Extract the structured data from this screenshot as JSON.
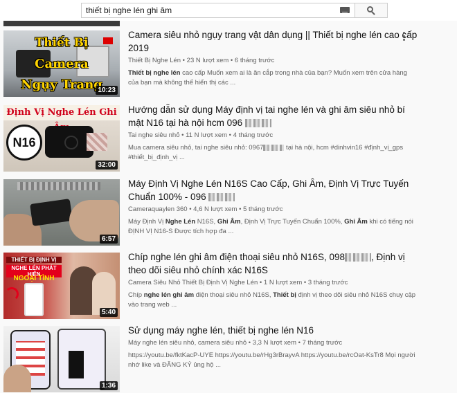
{
  "search": {
    "query": "thiết bị nghe lén ghi âm",
    "icons": {
      "keyboard": "keyboard-icon",
      "search": "search-icon"
    }
  },
  "results": [
    {
      "title": "Camera siêu nhỏ ngụy trang vật dân dụng || Thiết bị nghe lén cao cấp 2019",
      "channel": "Thiết Bị Nghe Lén",
      "views": "23 N lượt xem",
      "age": "6 tháng trước",
      "desc_bold": "Thiết bị nghe lén",
      "desc": " cao cấp Muốn xem ai là ăn cắp trong nhà của bạn? Muốn xem trên cửa hàng của bạn mà không thể hiển thị các ...",
      "duration": "10:23",
      "thumb_text": [
        "Thiết Bị",
        "Camera",
        "Ngụy Trang"
      ]
    },
    {
      "title_a": "Hướng dẫn sử dụng Máy định vị tai nghe lén và ghi âm siêu nhỏ bí mật N16 tại hà nội hcm 096",
      "channel": "Tai nghe siêu nhỏ",
      "views": "11 N lượt xem",
      "age": "4 tháng trước",
      "desc_a": "Mua camera siêu nhỏ, tai nghe siêu nhỏ: 0967",
      "desc_b": " tại hà nội, hcm #dinhvin16 #định_vị_gps #thiết_bị_định_vị ...",
      "duration": "32:00",
      "thumb_head": "Định Vị Nghe Lén Ghi Âm",
      "thumb_badge": "N16"
    },
    {
      "title_a": "Máy Định Vị Nghe Lén N16S Cao Cấp, Ghi Âm, Định Vị Trực Tuyến Chuẩn 100% - 096",
      "channel": "Cameraquaylen 360",
      "views": "4,6 N lượt xem",
      "age": "5 tháng trước",
      "desc_a": "Máy Định Vị ",
      "desc_b1": "Nghe Lén",
      "desc_c": " N16S, ",
      "desc_b2": "Ghi Âm",
      "desc_d": ", Định Vị Trực Tuyến Chuẩn 100%, ",
      "desc_b3": "Ghi Âm",
      "desc_e": " khi có tiếng nói ĐỊNH VỊ N16-S Được tích hợp đa ...",
      "duration": "6:57"
    },
    {
      "title_a": "Chíp nghe lén ghi âm điện thoại siêu nhỏ N16S, 098",
      "title_b": ", Định vị theo dõi siêu nhỏ chính xác N16S",
      "channel": "Camera Siêu Nhỏ Thiết Bị Định Vị Nghe Lén",
      "views": "1 N lượt xem",
      "age": "3 tháng trước",
      "desc_a": "Chíp ",
      "desc_b1": "nghe lén ghi âm",
      "desc_c": " điện thoại siêu nhỏ N16S, ",
      "desc_b2": "Thiết bị",
      "desc_d": " định vị theo dõi siêu nhỏ N16S chuy cập vào trang web ...",
      "duration": "5:40",
      "thumb_labels": [
        "THIẾT BỊ ĐỊNH VỊ",
        "NGHE LÉN PHÁT HIỆN",
        "NGOẠI TÌNH"
      ]
    },
    {
      "title": "Sử dụng máy nghe lén, thiết bị nghe lén N16",
      "channel": "Máy nghe lén siêu nhỏ, camera siêu nhỏ",
      "views": "3,3 N lượt xem",
      "age": "7 tháng trước",
      "desc": "https://youtu.be/fktKacP-UYE https://youtu.be/rHg3rBrayvA https://youtu.be/rcOat-KsTr8 Mọi người nhớ like và ĐĂNG KÝ ủng hộ ...",
      "duration": "1:36"
    }
  ],
  "icons": {
    "more": "more-vert-icon"
  }
}
